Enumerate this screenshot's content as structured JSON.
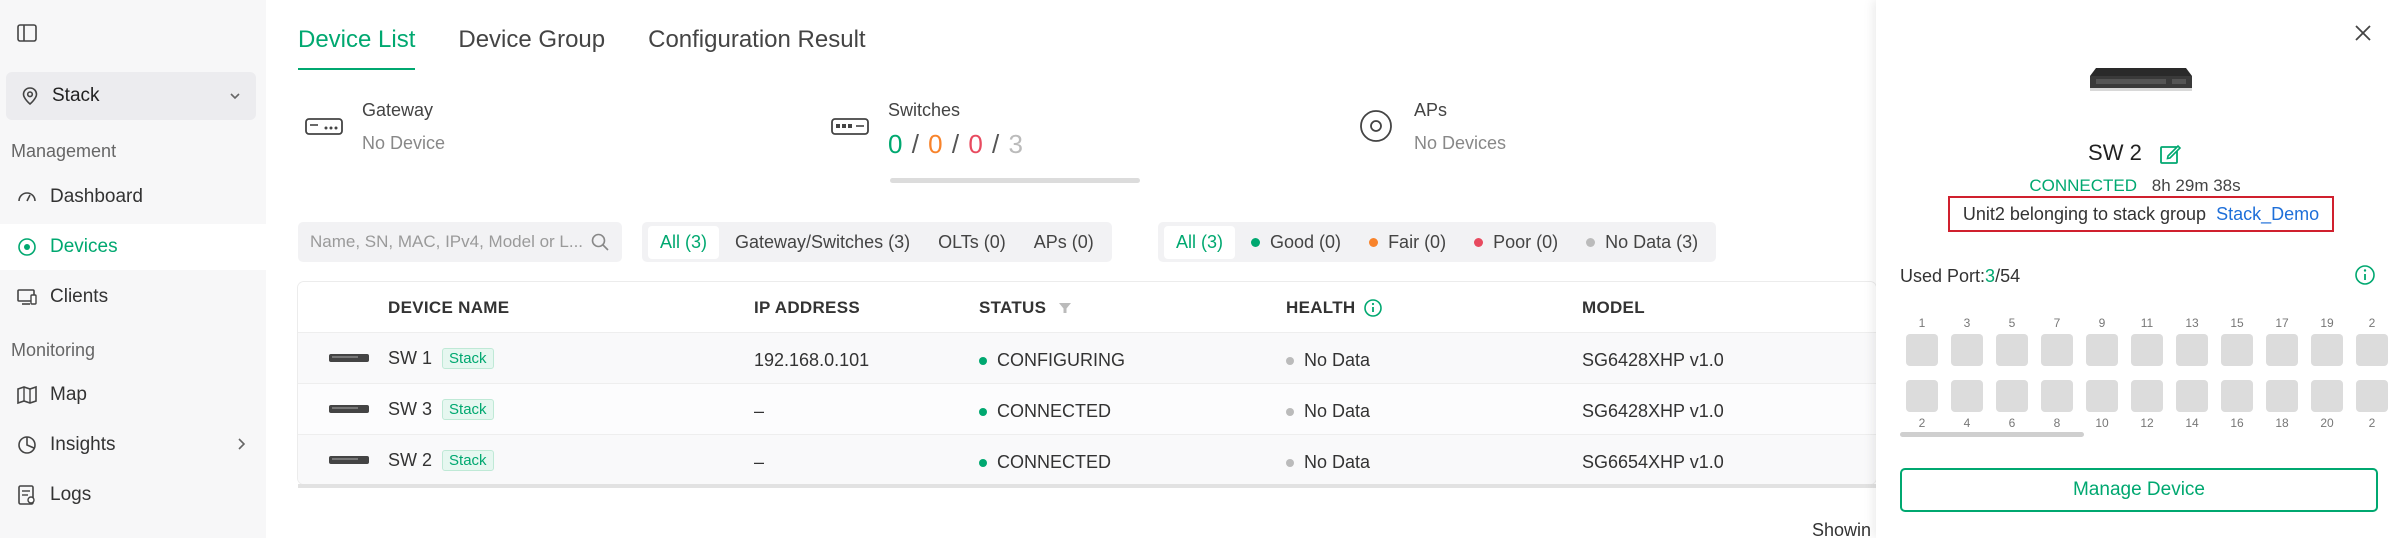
{
  "sidebar": {
    "site": "Stack",
    "sections": {
      "management": "Management",
      "monitoring": "Monitoring"
    },
    "items": [
      {
        "key": "dashboard",
        "label": "Dashboard"
      },
      {
        "key": "devices",
        "label": "Devices"
      },
      {
        "key": "clients",
        "label": "Clients"
      },
      {
        "key": "map",
        "label": "Map"
      },
      {
        "key": "insights",
        "label": "Insights"
      },
      {
        "key": "logs",
        "label": "Logs"
      }
    ],
    "active": "devices"
  },
  "tabs": [
    "Device List",
    "Device Group",
    "Configuration Result"
  ],
  "stats": {
    "gateway": {
      "title": "Gateway",
      "value": "No Device"
    },
    "switches": {
      "title": "Switches",
      "good": "0",
      "fair": "0",
      "poor": "0",
      "total": "3",
      "sep": "/"
    },
    "aps": {
      "title": "APs",
      "value": "No Devices"
    }
  },
  "search": {
    "placeholder": "Name, SN, MAC, IPv4, Model or L..."
  },
  "type_filter": [
    "All (3)",
    "Gateway/Switches (3)",
    "OLTs (0)",
    "APs (0)"
  ],
  "health_filter": [
    {
      "label": "All (3)",
      "color": ""
    },
    {
      "label": "Good (0)",
      "color": "#00a870"
    },
    {
      "label": "Fair (0)",
      "color": "#f8832b"
    },
    {
      "label": "Poor (0)",
      "color": "#e84a5f"
    },
    {
      "label": "No Data (3)",
      "color": "#bbbbbb"
    }
  ],
  "table": {
    "columns": [
      "DEVICE NAME",
      "IP ADDRESS",
      "STATUS",
      "HEALTH",
      "MODEL"
    ],
    "rows": [
      {
        "name": "SW 1",
        "tag": "Stack",
        "ip": "192.168.0.101",
        "status": "CONFIGURING",
        "health": "No Data",
        "model": "SG6428XHP v1.0"
      },
      {
        "name": "SW 3",
        "tag": "Stack",
        "ip": "–",
        "status": "CONNECTED",
        "health": "No Data",
        "model": "SG6428XHP v1.0"
      },
      {
        "name": "SW 2",
        "tag": "Stack",
        "ip": "–",
        "status": "CONNECTED",
        "health": "No Data",
        "model": "SG6654XHP v1.0"
      }
    ]
  },
  "footer": {
    "showing": "Showin"
  },
  "panel": {
    "device_name": "SW 2",
    "status": "CONNECTED",
    "uptime": "8h 29m 38s",
    "stack_text": "Unit2 belonging to stack group",
    "stack_group": "Stack_Demo",
    "used_port_label": "Used Port:",
    "used_ports": "3",
    "total_ports": "/54",
    "top_ports": [
      "1",
      "3",
      "5",
      "7",
      "9",
      "11",
      "13",
      "15",
      "17",
      "19",
      "2"
    ],
    "bottom_ports": [
      "2",
      "4",
      "6",
      "8",
      "10",
      "12",
      "14",
      "16",
      "18",
      "20",
      "2"
    ],
    "manage_label": "Manage Device"
  },
  "colors": {
    "accent": "#00a870",
    "link": "#1e6fd9",
    "highlight_box": "#d0202e"
  },
  "icons": [
    "sidebar-toggle-icon",
    "location-pin-icon",
    "chevron-down-icon",
    "dashboard-icon",
    "devices-icon",
    "clients-icon",
    "map-icon",
    "insights-icon",
    "chevron-right-icon",
    "logs-icon",
    "gateway-icon",
    "switch-icon",
    "ap-icon",
    "search-icon",
    "filter-icon",
    "info-icon",
    "close-icon",
    "edit-icon"
  ]
}
